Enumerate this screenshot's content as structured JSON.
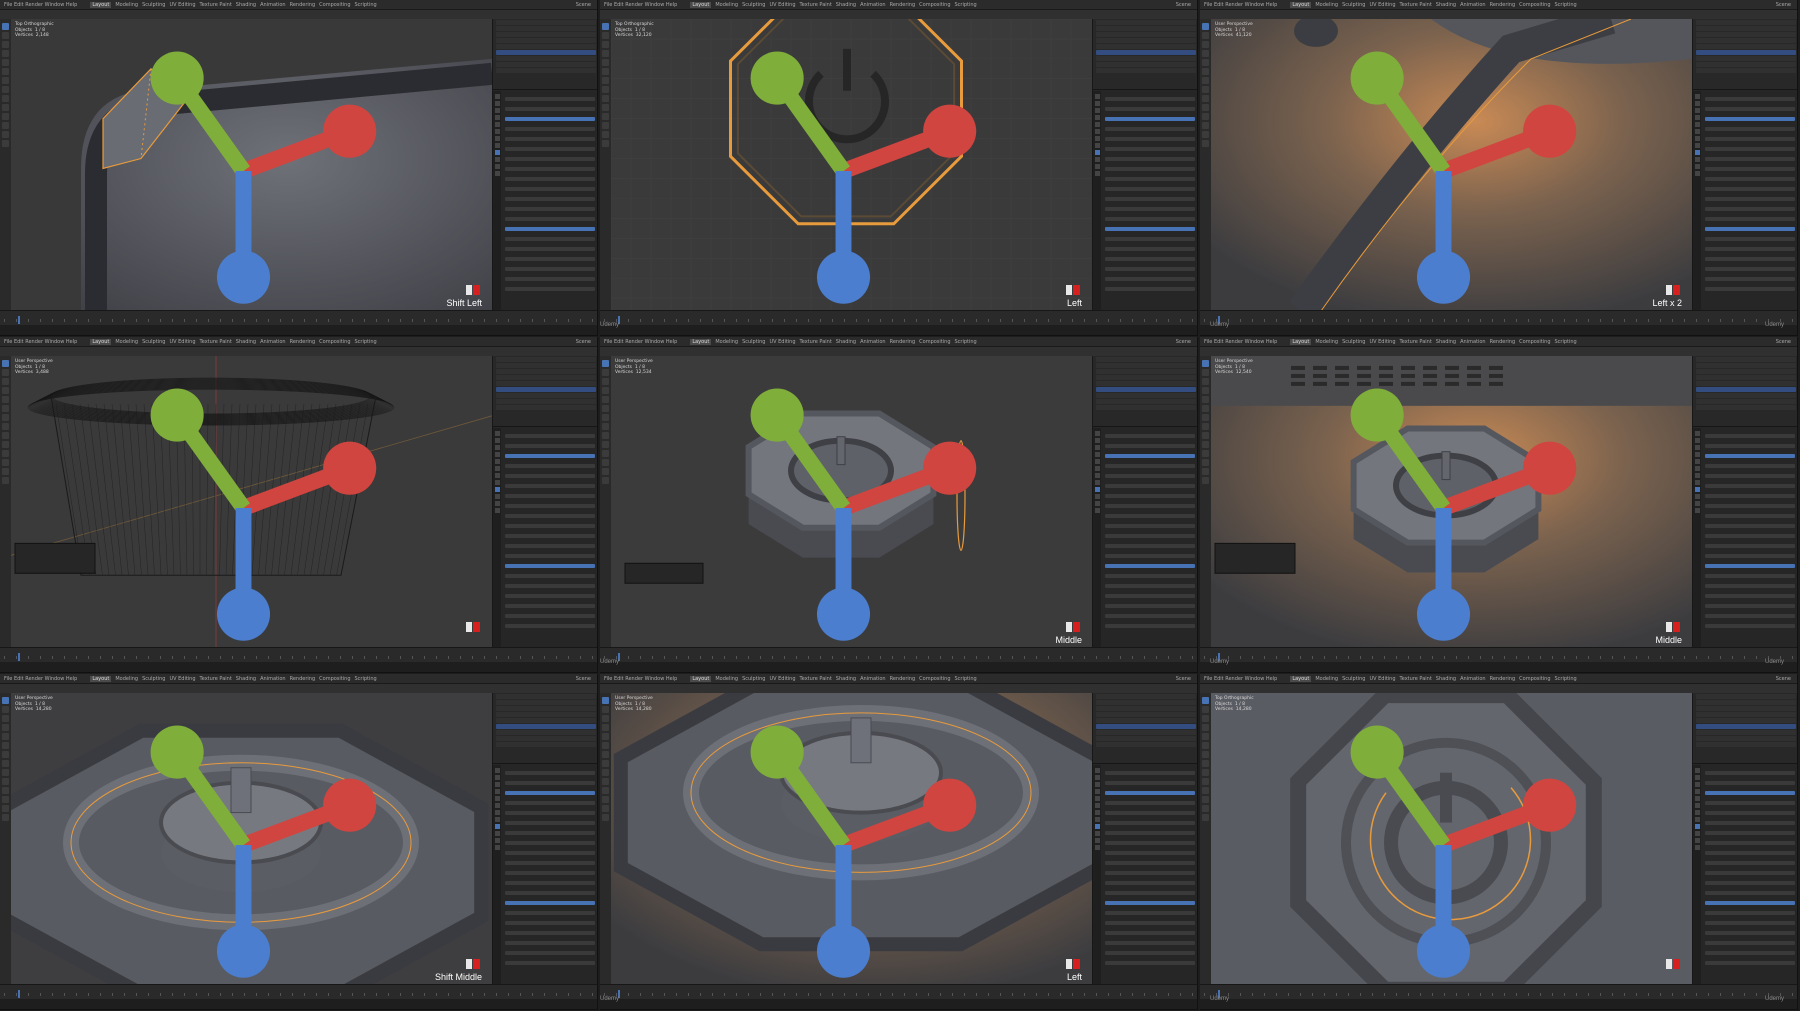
{
  "app": {
    "menus": "File  Edit  Render  Window  Help",
    "workspaces": [
      "Layout",
      "Modeling",
      "Sculpting",
      "UV Editing",
      "Texture Paint",
      "Shading",
      "Animation",
      "Rendering",
      "Compositing",
      "Scripting"
    ],
    "active_workspace": "Layout",
    "scene_label": "Scene",
    "watermark": "Udemy"
  },
  "panels": [
    {
      "id": "p1",
      "key_hint": "Shift Left",
      "view": "Top Orthographic",
      "stats": "Objects  1 / 8\nVertices  2,148"
    },
    {
      "id": "p2",
      "key_hint": "Left",
      "view": "Top Orthographic",
      "stats": "Objects  1 / 8\nVertices  32,120"
    },
    {
      "id": "p3",
      "key_hint": "Left x 2",
      "view": "User Perspective",
      "stats": "Objects  1 / 8\nVertices  41,120"
    },
    {
      "id": "p4",
      "key_hint": "",
      "view": "User Perspective",
      "stats": "Objects  1 / 8\nVertices  3,488"
    },
    {
      "id": "p5",
      "key_hint": "Middle",
      "view": "User Perspective",
      "stats": "Objects  1 / 8\nVertices  12,534"
    },
    {
      "id": "p6",
      "key_hint": "Middle",
      "view": "User Perspective",
      "stats": "Objects  1 / 8\nVertices  12,540"
    },
    {
      "id": "p7",
      "key_hint": "Shift Middle",
      "view": "User Perspective",
      "stats": "Objects  1 / 8\nVertices  14,280"
    },
    {
      "id": "p8",
      "key_hint": "Left",
      "view": "User Perspective",
      "stats": "Objects  1 / 8\nVertices  14,280"
    },
    {
      "id": "p9",
      "key_hint": "",
      "view": "Top Orthographic",
      "stats": "Objects  1 / 8\nVertices  14,280"
    }
  ],
  "icons": {
    "mouse_left": "mouse-left-button-icon",
    "mouse_right": "mouse-right-button-icon",
    "gizmo": "navigation-gizmo-icon"
  },
  "colors": {
    "accent": "#4772b3",
    "selection_orange": "#e89b3c",
    "mouse_red": "#d61f1f"
  }
}
